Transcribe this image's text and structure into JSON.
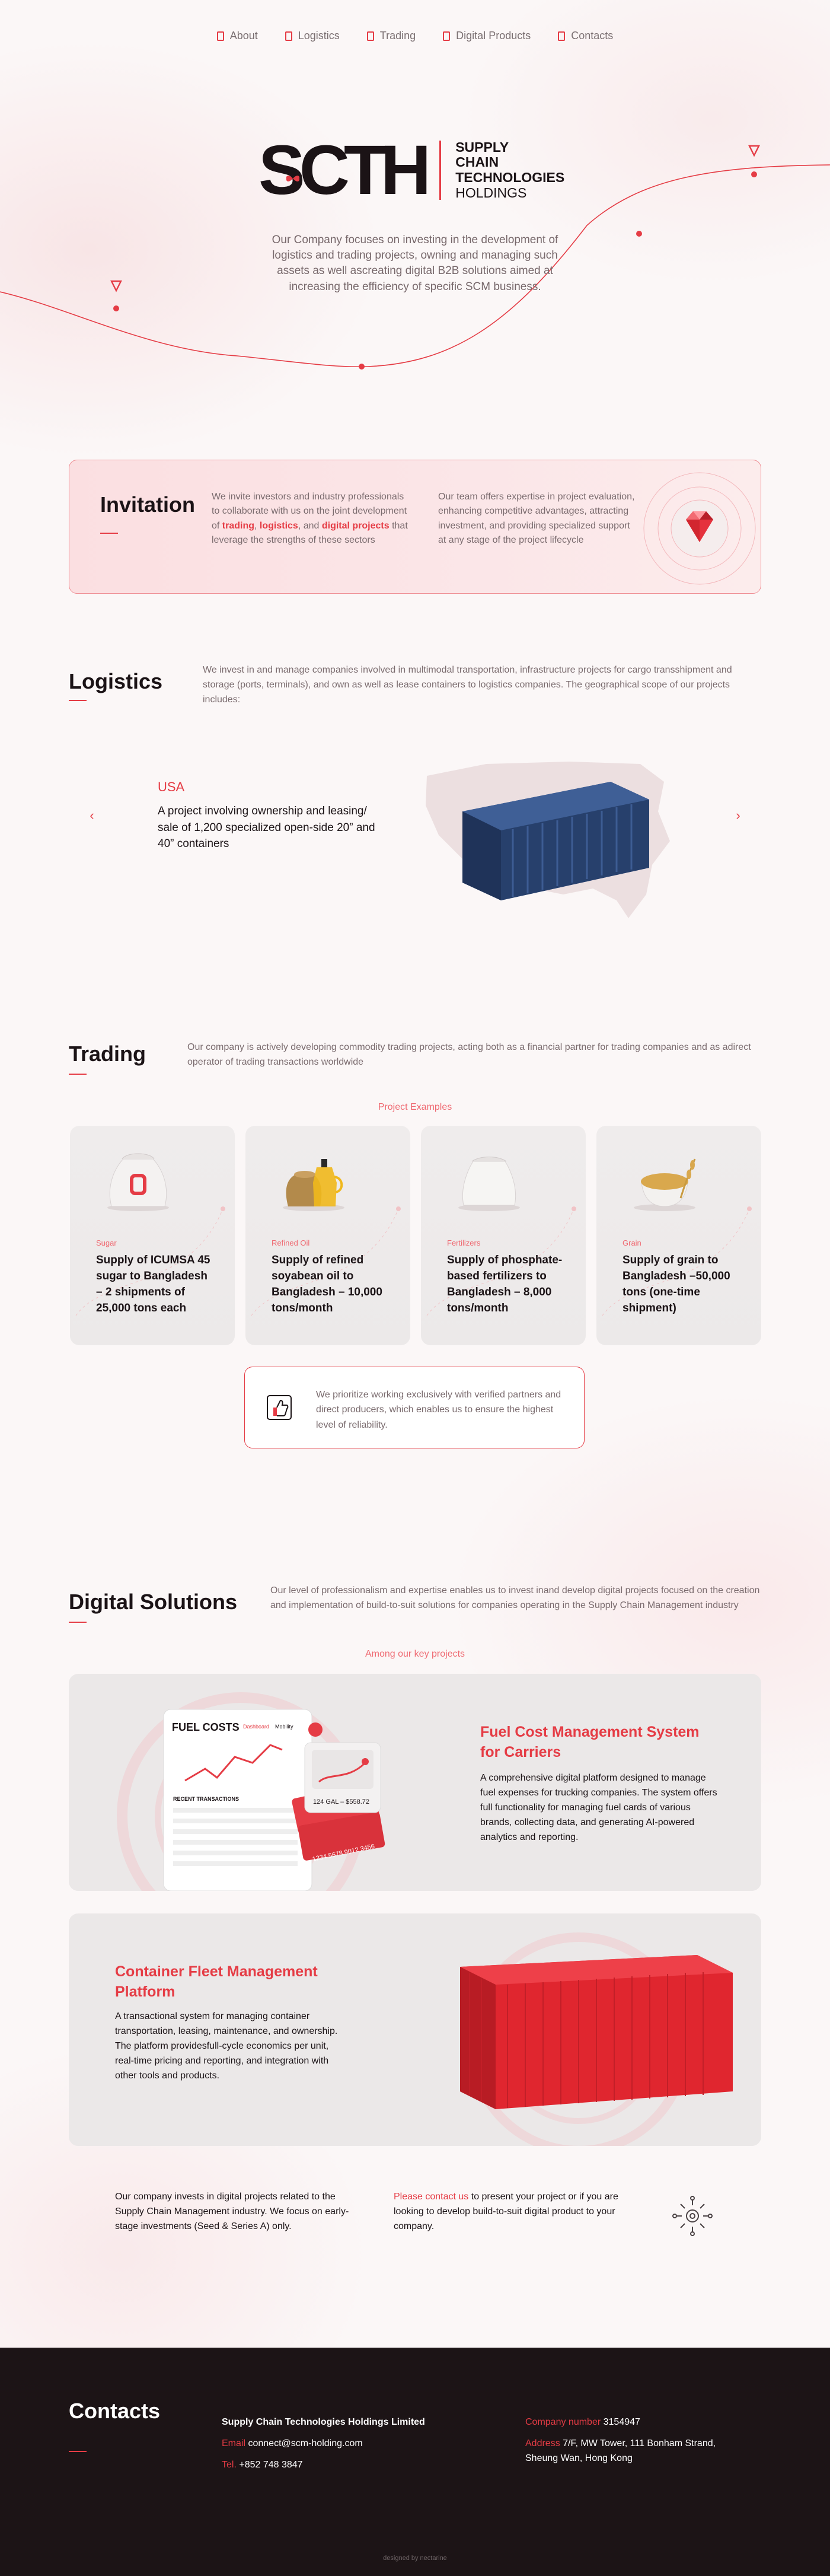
{
  "nav": {
    "items": [
      "About",
      "Logistics",
      "Trading",
      "Digital Products",
      "Contacts"
    ]
  },
  "hero": {
    "logo_mark": "SCTH",
    "logo_lines": [
      "SUPPLY",
      "CHAIN",
      "TECHNOLOGIES"
    ],
    "logo_last": "HOLDINGS",
    "description": "Our Company focuses on investing in the development of logistics and trading projects, owning and managing such assets as well ascreating digital B2B solutions aimed at increasing the efficiency of specific SCM business."
  },
  "invitation": {
    "title": "Invitation",
    "col1_a": "We invite investors and industry professionals to collaborate with us on the joint development of ",
    "col1_hl1": "trading",
    "col1_sep1": ", ",
    "col1_hl2": "logistics",
    "col1_sep2": ", and ",
    "col1_hl3": "digital projects",
    "col1_b": " that leverage the strengths of these sectors",
    "col2": "Our team offers expertise in project evaluation, enhancing competitive advantages, attracting investment, and providing specialized support at any stage of the project lifecycle"
  },
  "logistics": {
    "title": "Logistics",
    "description": "We invest in and manage companies involved in multimodal transportation, infrastructure projects for cargo transshipment and storage (ports, terminals), and own as well as lease containers to logistics companies. The geographical scope of our projects includes:",
    "slide": {
      "country": "USA",
      "text": "A project involving ownership and leasing/ sale of 1,200 specialized open-side 20” and 40” containers"
    },
    "prev_icon": "‹",
    "next_icon": "›"
  },
  "trading": {
    "title": "Trading",
    "description": "Our company is actively developing commodity trading projects, acting both as a financial partner for trading companies and as adirect operator of trading transactions worldwide",
    "examples_label": "Project Examples",
    "cards": [
      {
        "category": "Sugar",
        "title": "Supply of ICUMSA 45 sugar to Bangladesh – 2 shipments of 25,000 tons each"
      },
      {
        "category": "Refined Oil",
        "title": "Supply of refined soyabean oil to Bangladesh – 10,000 tons/month"
      },
      {
        "category": "Fertilizers",
        "title": "Supply of phosphate-based  fertilizers to Bangladesh – 8,000 tons/month"
      },
      {
        "category": "Grain",
        "title": "Supply of grain to Bangladesh –50,000 tons (one-time shipment)"
      }
    ],
    "reliability": "We prioritize working exclusively with verified partners and direct producers, which enables us to ensure the highest level of reliability."
  },
  "digital": {
    "title": "Digital Solutions",
    "description": "Our level of professionalism and expertise enables us to invest inand develop digital projects focused on the creation and implementation of build-to-suit solutions for companies operating in the Supply Chain Management industry",
    "key_label": "Among our key projects",
    "project1": {
      "title": "Fuel Cost Management System for Carriers",
      "text": "A comprehensive digital platform designed to manage fuel expenses for trucking companies. The system offers full functionality for managing fuel cards of various brands, collecting data, and generating AI-powered analytics and reporting.",
      "mock_title": "FUEL COSTS",
      "mock_tab1": "Dashboard",
      "mock_tab2": "Mobility",
      "mock_recent": "RECENT TRANSACTIONS",
      "mock_amount": "124 GAL – $558.72",
      "mock_card": "1234 5678 9012 3456"
    },
    "project2": {
      "title": "Container Fleet Management Platform",
      "text": "A transactional system for managing container transportation, leasing, maintenance, and ownership. The platform providesfull-cycle economics per unit, real-time pricing and reporting, and integration  with other tools and products."
    },
    "note_left": "Our company invests in digital projects related to the Supply Chain Management industry. We focus on early-stage investments (Seed & Series A) only.",
    "note_right_hl": "Please contact us",
    "note_right": " to present your project or if you are looking to develop build-to-suit digital product to your company."
  },
  "contacts": {
    "title": "Contacts",
    "company": "Supply Chain Technologies Holdings Limited",
    "email_label": "Email",
    "email": "connect@scm-holding.com",
    "tel_label": "Tel.",
    "tel": "+852 748 3847",
    "number_label": "Company number",
    "number": "3154947",
    "address_label": "Address",
    "address": "7/F, MW Tower, 111 Bonham Strand, Sheung Wan, Hong Kong",
    "credit": "designed by nectarine"
  },
  "colors": {
    "accent": "#e53c45",
    "dark": "#1c1416",
    "muted": "#7a6b6e"
  }
}
